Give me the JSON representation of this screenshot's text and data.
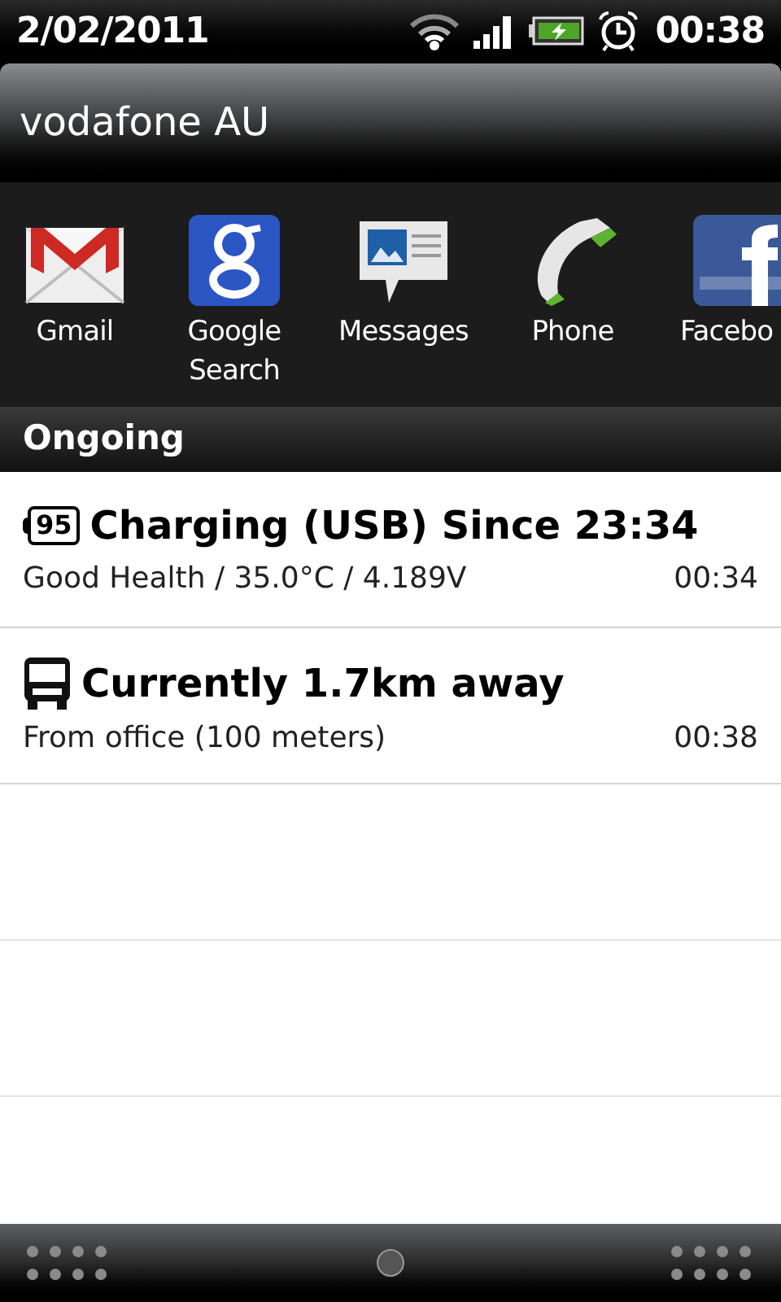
{
  "status_bar": {
    "date": "2/02/2011",
    "time": "00:38"
  },
  "carrier": {
    "title": "vodafone AU"
  },
  "apps": [
    {
      "label": "Gmail",
      "kind": "gmail"
    },
    {
      "label": "Google Search",
      "kind": "google"
    },
    {
      "label": "Messages",
      "kind": "messages"
    },
    {
      "label": "Phone",
      "kind": "phone"
    },
    {
      "label": "Facebo",
      "kind": "facebook"
    }
  ],
  "section": {
    "title": "Ongoing"
  },
  "notifications": [
    {
      "kind": "battery",
      "badge": "95",
      "title": "Charging (USB) Since 23:34",
      "detail": "Good Health / 35.0°C / 4.189V",
      "time": "00:34"
    },
    {
      "kind": "bus",
      "title": "Currently 1.7km away",
      "detail": "From office (100 meters)",
      "time": "00:38"
    }
  ]
}
